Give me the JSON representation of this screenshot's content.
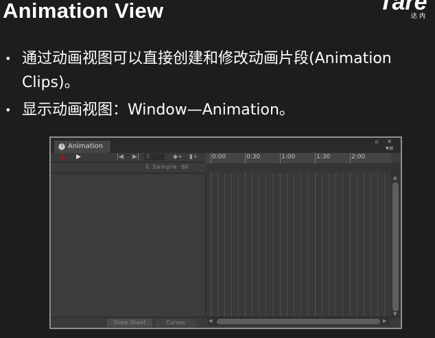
{
  "slide": {
    "title": "Animation View",
    "logo_text": "Tare",
    "logo_sub": "达内",
    "bullet_symbol": "•",
    "bullets": [
      "通过动画视图可以直接创建和修改动画片段(Animation Clips)。",
      "显示动画视图：Window—Animation。"
    ]
  },
  "animation_window": {
    "tab_label": "Animation",
    "window_controls": "▫ ✕",
    "menu_glyph": "▾≡",
    "toolbar": {
      "record_icon": "record-icon",
      "play_glyph": "▶",
      "prev_glyph": "|◀",
      "next_glyph": "▶|",
      "frame_value": "0",
      "add_key_glyph": "◆+",
      "add_event_glyph": "▮+"
    },
    "sample": {
      "arrows": "⇕",
      "label": "Sample",
      "value": "60"
    },
    "timeline_ticks": [
      "0:00",
      "0:30",
      "1:00",
      "1:30",
      "2:00"
    ],
    "bottom_tabs": [
      "Dope Sheet",
      "Curves"
    ],
    "scroll_left_glyph": "◀",
    "scroll_right_glyph": "▶",
    "scroll_up_glyph": "▲",
    "scroll_down_glyph": "▼",
    "colors": {
      "panel_bg": "#3c3c3c",
      "record_red": "#8a1e1e",
      "window_border": "#8f8f8f"
    }
  }
}
